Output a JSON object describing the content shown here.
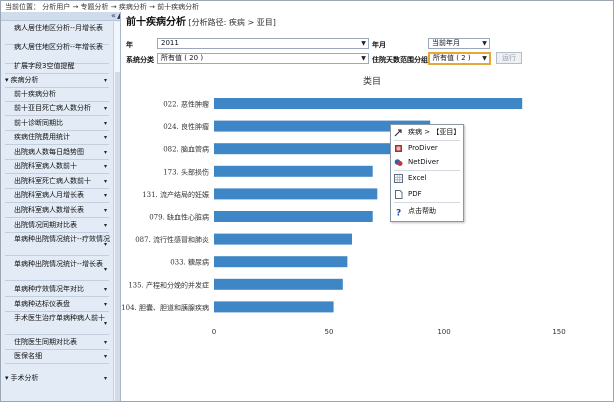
{
  "breadcrumb": "当前位置： 分析用户 → 专题分析 → 疾病分析 → 前十疾病分析",
  "sidebar": {
    "items": [
      {
        "label": "病人居住地区分析--月增长表",
        "type": "sub",
        "caret": false
      },
      {
        "label": "病人居住地区分析--年增长表",
        "type": "sub",
        "caret": false
      },
      {
        "label": "扩展字段3空值提醒",
        "type": "sub",
        "caret": false
      },
      {
        "label": "疾病分析",
        "type": "group",
        "caret": true
      },
      {
        "label": "前十疾病分析",
        "type": "sub",
        "caret": false
      },
      {
        "label": "前十亚目死亡病人数分析",
        "type": "sub",
        "caret": true
      },
      {
        "label": "前十诊断同期比",
        "type": "sub",
        "caret": true
      },
      {
        "label": "疾病住院费用统计",
        "type": "sub",
        "caret": true
      },
      {
        "label": "出院病人数每日趋势图",
        "type": "sub",
        "caret": true
      },
      {
        "label": "出院科室病人数前十",
        "type": "sub",
        "caret": true
      },
      {
        "label": "出院科室死亡病人数前十",
        "type": "sub",
        "caret": true
      },
      {
        "label": "出院科室病人月增长表",
        "type": "sub",
        "caret": true
      },
      {
        "label": "出院科室病人数增长表",
        "type": "sub",
        "caret": true
      },
      {
        "label": "出院情况同期对比表",
        "type": "sub",
        "caret": true
      },
      {
        "label": "单病种出院情况统计--疗效情况",
        "type": "sub",
        "caret": true
      },
      {
        "label": "单病种出院情况统计--增长表",
        "type": "sub",
        "caret": true
      },
      {
        "label": "单病种疗效情况年对比",
        "type": "sub",
        "caret": true
      },
      {
        "label": "单病种达标仪表盘",
        "type": "sub",
        "caret": true
      },
      {
        "label": "手术医生治疗单病种病人前十",
        "type": "sub",
        "caret": true
      },
      {
        "label": "住院医生同期对比表",
        "type": "sub",
        "caret": true
      },
      {
        "label": "医保名细",
        "type": "sub",
        "caret": true
      },
      {
        "label": "手术分析",
        "type": "group",
        "caret": true
      }
    ]
  },
  "header": {
    "title": "前十疾病分析",
    "path": "[分析路径: 疾病 > 亚目]"
  },
  "filters": {
    "year_label": "年",
    "year_value": "2011",
    "month_label": "年月",
    "month_value": "当前年月",
    "category_label": "系统分类",
    "category_value": "所有值 ( 20 )",
    "days_label": "住院天数范围分组",
    "days_value": "所有值 ( 2 )",
    "run_label": "运行"
  },
  "chart_data": {
    "type": "bar",
    "orientation": "horizontal",
    "title": "类目",
    "categories": [
      "022. 恶性肿瘤",
      "024. 良性肿瘤",
      "082. 脑血管病",
      "173. 头部损伤",
      "131. 流产结局的妊娠",
      "079. 缺血性心脏病",
      "087. 流行性感冒和肺炎",
      "033. 糖尿病",
      "135. 产程和分娩的并发症",
      "104. 胆囊、胆道和胰腺疾病"
    ],
    "values": [
      134,
      94,
      78,
      69,
      71,
      69,
      60,
      58,
      56,
      52
    ],
    "xlim": [
      0,
      160
    ],
    "xticks": [
      0,
      50,
      100,
      150
    ],
    "bar_color": "#3f86c7"
  },
  "context_menu": {
    "items": [
      {
        "label": "疾病 > 【亚目】",
        "icon": "drill-icon"
      },
      {
        "label": "ProDiver",
        "icon": "prodiver-icon"
      },
      {
        "label": "NetDiver",
        "icon": "netdiver-icon"
      },
      {
        "label": "Excel",
        "icon": "excel-icon"
      },
      {
        "label": "PDF",
        "icon": "pdf-icon"
      },
      {
        "label": "点击帮助",
        "icon": "help-icon"
      }
    ]
  }
}
